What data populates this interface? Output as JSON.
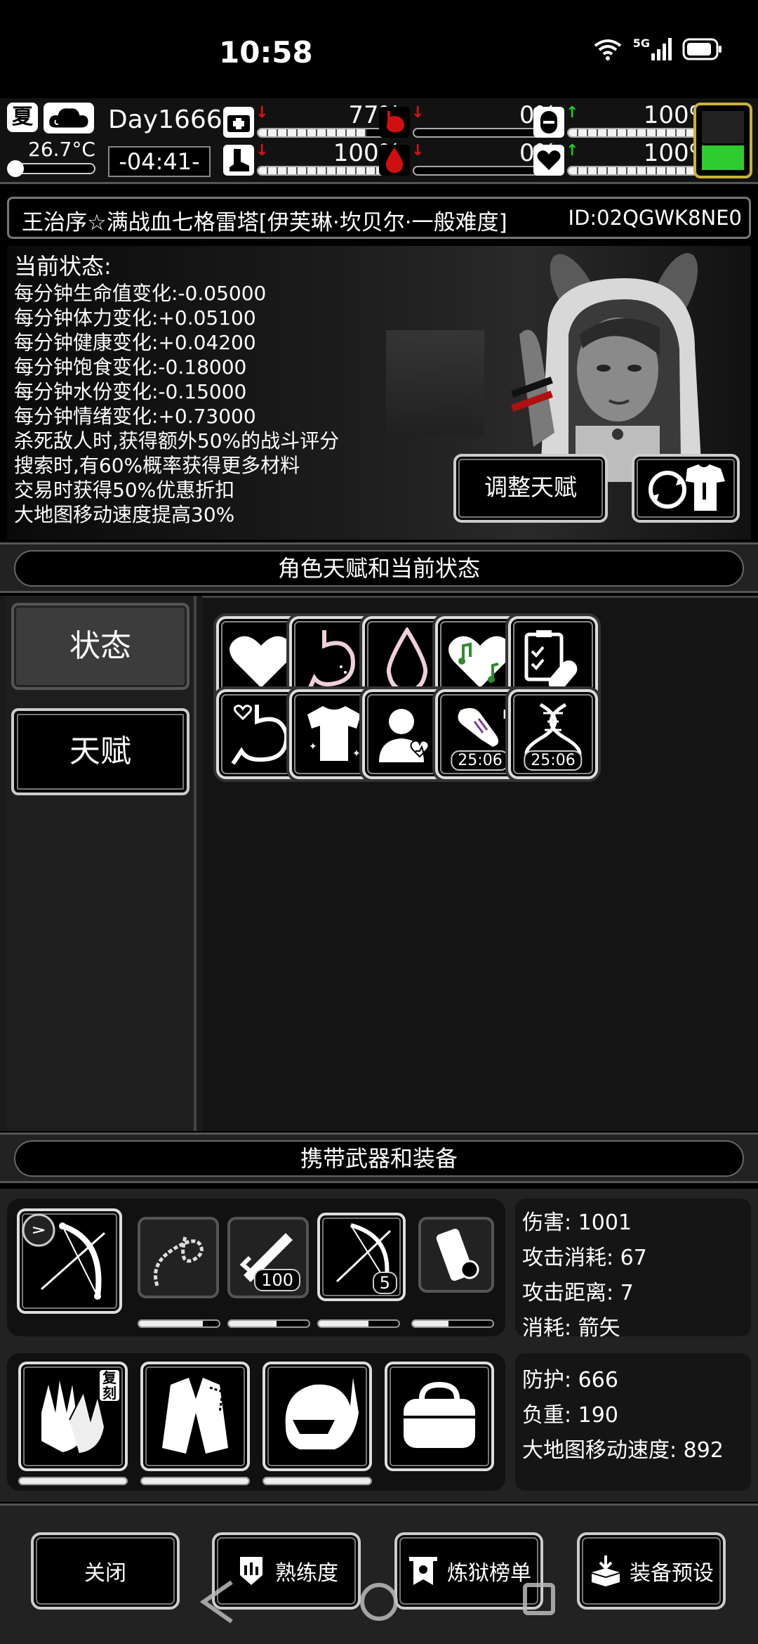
{
  "system": {
    "time": "10:58",
    "network_label": "5G"
  },
  "hud": {
    "season": "夏",
    "temperature": "26.7°C",
    "day": "Day1666",
    "clock": "-04:41-",
    "meters": [
      {
        "name": "health",
        "value": "77%",
        "level": 0.77,
        "trend": "down"
      },
      {
        "name": "hunger",
        "value": "0%",
        "level": 0.0,
        "trend": "down"
      },
      {
        "name": "mood",
        "value": "100%",
        "level": 1.0,
        "trend": "up"
      },
      {
        "name": "stamina",
        "value": "100%",
        "level": 1.0,
        "trend": "down"
      },
      {
        "name": "thirst",
        "value": "0%",
        "level": 0.0,
        "trend": "down"
      },
      {
        "name": "heart",
        "value": "100%",
        "level": 1.0,
        "trend": "up"
      }
    ],
    "battery_level": 0.35
  },
  "title": {
    "name": "王治序☆满战血七格雷塔[伊芙琳·坎贝尔·一般难度]",
    "id": "ID:02QGWK8NE0"
  },
  "status": {
    "heading": "当前状态:",
    "lines": [
      "每分钟生命值变化:-0.05000",
      "每分钟体力变化:+0.05100",
      "每分钟健康变化:+0.04200",
      "每分钟饱食变化:-0.18000",
      "每分钟水份变化:-0.15000",
      "每分钟情绪变化:+0.73000",
      "杀死敌人时,获得额外50%的战斗评分",
      "搜索时,有60%概率获得更多材料",
      "交易时获得50%优惠折扣",
      "大地图移动速度提高30%"
    ],
    "adjust_button": "调整天赋"
  },
  "sections": {
    "talent_header": "角色天赋和当前状态",
    "equip_header": "携带武器和装备"
  },
  "tabs": {
    "status": "状态",
    "talent": "天赋"
  },
  "status_slots": [
    {
      "icon": "heart-icon"
    },
    {
      "icon": "stomach-icon"
    },
    {
      "icon": "water-drop-icon"
    },
    {
      "icon": "music-heart-icon"
    },
    {
      "icon": "medical-kit-icon"
    },
    {
      "icon": "stomach-heart-icon"
    },
    {
      "icon": "shirt-icon"
    },
    {
      "icon": "person-heartbeat-icon"
    },
    {
      "icon": "injured-arm-icon",
      "timer": "25:06"
    },
    {
      "icon": "dna-icon",
      "timer": "25:06"
    }
  ],
  "weapons": {
    "ammo_gun": "100",
    "ammo_bow": "5",
    "durability": [
      0.8,
      0.6,
      0.62,
      0.62,
      0.45
    ],
    "stats": [
      "伤害: 1001",
      "攻击消耗: 67",
      "攻击距离: 7",
      "消耗: 箭矢"
    ]
  },
  "armor": {
    "glove_badge": "复刻",
    "durability": [
      1.0,
      1.0,
      1.0
    ],
    "stats": [
      "防护: 666",
      "负重: 190",
      "大地图移动速度: 892"
    ]
  },
  "bottom_buttons": {
    "close": "关闭",
    "proficiency": "熟练度",
    "ranking": "炼狱榜单",
    "preset": "装备预设"
  }
}
